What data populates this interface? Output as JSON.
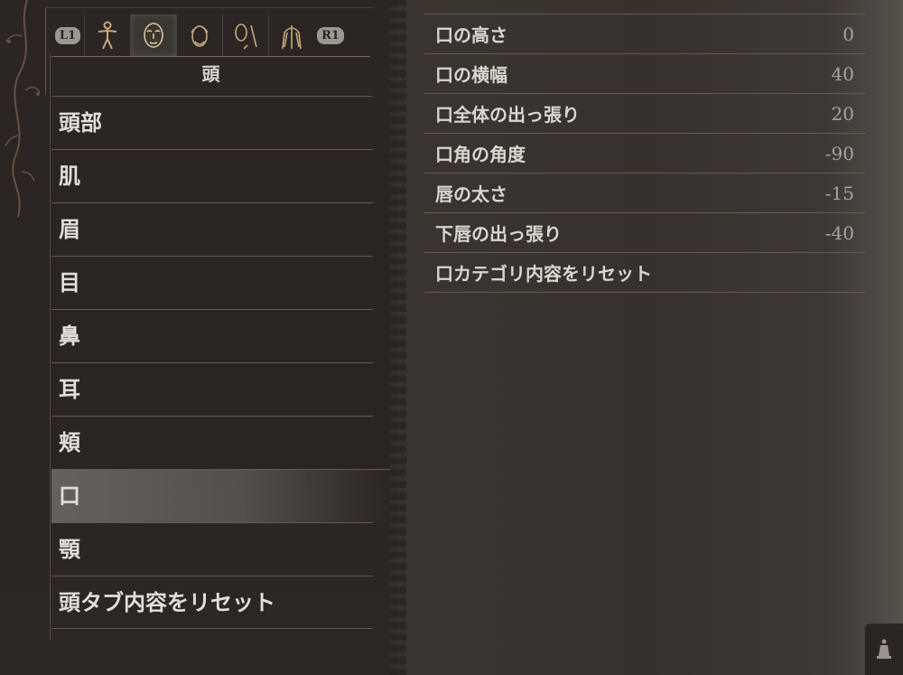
{
  "tabs": {
    "left_button": "L1",
    "right_button": "R1",
    "icons": [
      "body-figure-icon",
      "face-icon",
      "hair-icon",
      "accessory-icon",
      "torso-icon"
    ],
    "active_index": 1,
    "title": "頭"
  },
  "categories": [
    {
      "label": "頭部"
    },
    {
      "label": "肌"
    },
    {
      "label": "眉"
    },
    {
      "label": "目"
    },
    {
      "label": "鼻"
    },
    {
      "label": "耳"
    },
    {
      "label": "頬"
    },
    {
      "label": "口",
      "selected": true
    },
    {
      "label": "顎"
    },
    {
      "label": "頭タブ内容をリセット"
    }
  ],
  "settings": [
    {
      "label": "口の高さ",
      "value": "0"
    },
    {
      "label": "口の横幅",
      "value": "40"
    },
    {
      "label": "口全体の出っ張り",
      "value": "20"
    },
    {
      "label": "口角の角度",
      "value": "-90"
    },
    {
      "label": "唇の太さ",
      "value": "-15"
    },
    {
      "label": "下唇の出っ張り",
      "value": "-40"
    },
    {
      "label": "口カテゴリ内容をリセット",
      "value": ""
    }
  ],
  "colors": {
    "background": "#2a2523",
    "text": "#e4ded8",
    "value_text": "#a9a39c",
    "divider": "#6d5a4b",
    "selected_highlight": "#78766f"
  }
}
